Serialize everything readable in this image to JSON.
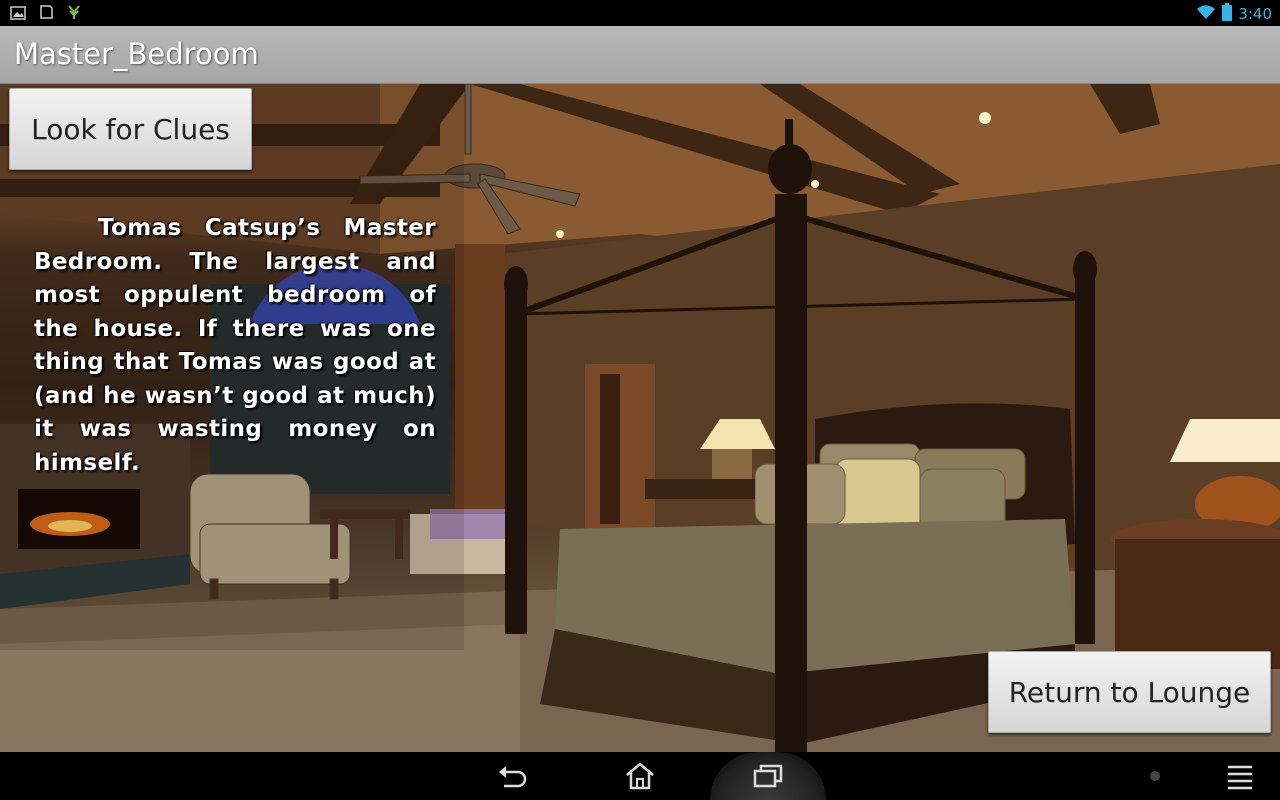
{
  "status_bar": {
    "time": "3:40",
    "left_icons": [
      "gallery-notification-icon",
      "app-notification-icon",
      "plant-notification-icon"
    ],
    "right_icons": [
      "wifi-icon",
      "battery-icon"
    ],
    "time_color": "#33b5e5"
  },
  "action_bar": {
    "title": "Master_Bedroom"
  },
  "main": {
    "look_for_clues_label": "Look for Clues",
    "description": "Tomas Catsup’s Master Bedroom. The largest and most oppulent bedroom of the house. If there was one thing that Tomas was good at (and he wasn’t good at much) it was wasting money on himself.",
    "return_label": "Return to Lounge"
  },
  "nav_bar": {
    "icons": [
      "back-icon",
      "home-icon",
      "recent-apps-icon",
      "menu-icon"
    ]
  }
}
